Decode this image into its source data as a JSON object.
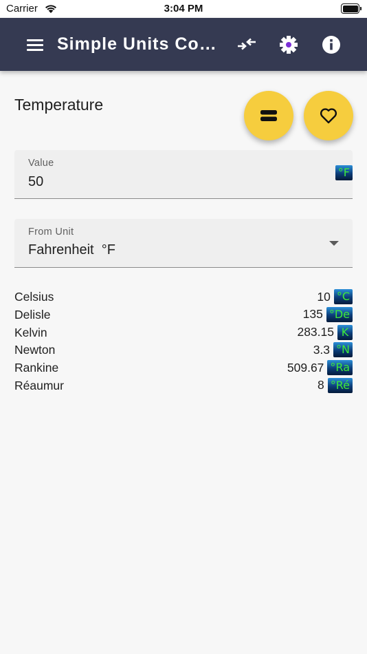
{
  "status_bar": {
    "carrier": "Carrier",
    "time": "3:04 PM"
  },
  "app_bar": {
    "title": "Simple Units Con…",
    "background": "#353a52",
    "icons": [
      "menu-icon",
      "swap-arrows-icon",
      "gear-icon",
      "info-icon"
    ]
  },
  "main": {
    "section_title": "Temperature",
    "fab_accent": "#f6cd3e",
    "fab_icons": [
      "equals-icon",
      "heart-icon"
    ],
    "value_field": {
      "label": "Value",
      "value": "50",
      "unit_badge": "°F"
    },
    "from_unit_field": {
      "label": "From Unit",
      "selected": "Fahrenheit  °F"
    },
    "results": [
      {
        "name": "Celsius",
        "value": "10",
        "unit": "°C"
      },
      {
        "name": "Delisle",
        "value": "135",
        "unit": "°De"
      },
      {
        "name": "Kelvin",
        "value": "283.15",
        "unit": "K"
      },
      {
        "name": "Newton",
        "value": "3.3",
        "unit": "°N"
      },
      {
        "name": "Rankine",
        "value": "509.67",
        "unit": "°Ra"
      },
      {
        "name": "Réaumur",
        "value": "8",
        "unit": "°Ré"
      }
    ]
  }
}
